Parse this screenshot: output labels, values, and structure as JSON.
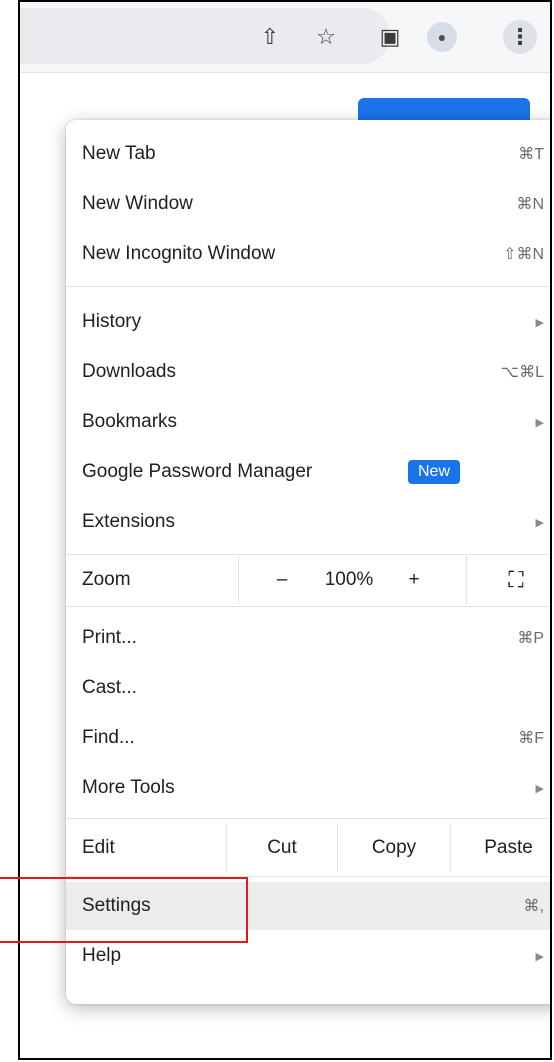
{
  "toolbar": {
    "icons": [
      "share-icon",
      "star-icon",
      "side-panel-icon",
      "profile-icon",
      "more-options-icon"
    ],
    "share_glyph": "⇧",
    "star_glyph": "☆",
    "panel_glyph": "▣",
    "profile_glyph": "●",
    "kebab_glyph": "⋮"
  },
  "menu": {
    "new_tab": {
      "label": "New Tab",
      "shortcut": "⌘T"
    },
    "new_window": {
      "label": "New Window",
      "shortcut": "⌘N"
    },
    "new_incognito": {
      "label": "New Incognito Window",
      "shortcut": "⇧⌘N"
    },
    "history": {
      "label": "History",
      "arrow": "▶"
    },
    "downloads": {
      "label": "Downloads",
      "shortcut": "⌥⌘L"
    },
    "bookmarks": {
      "label": "Bookmarks",
      "arrow": "▶"
    },
    "password_manager": {
      "label": "Google Password Manager",
      "badge": "New"
    },
    "extensions": {
      "label": "Extensions",
      "arrow": "▶"
    },
    "zoom": {
      "label": "Zoom",
      "minus": "–",
      "value": "100%",
      "plus": "+",
      "fullscreen": "⛶"
    },
    "print": {
      "label": "Print...",
      "shortcut": "⌘P"
    },
    "cast": {
      "label": "Cast..."
    },
    "find": {
      "label": "Find...",
      "shortcut": "⌘F"
    },
    "more_tools": {
      "label": "More Tools",
      "arrow": "▶"
    },
    "edit": {
      "label": "Edit",
      "cut": "Cut",
      "copy": "Copy",
      "paste": "Paste"
    },
    "settings": {
      "label": "Settings",
      "shortcut": "⌘,"
    },
    "help": {
      "label": "Help",
      "arrow": "▶"
    }
  },
  "colors": {
    "accent": "#1a73e8",
    "highlight_box": "#d42020"
  }
}
